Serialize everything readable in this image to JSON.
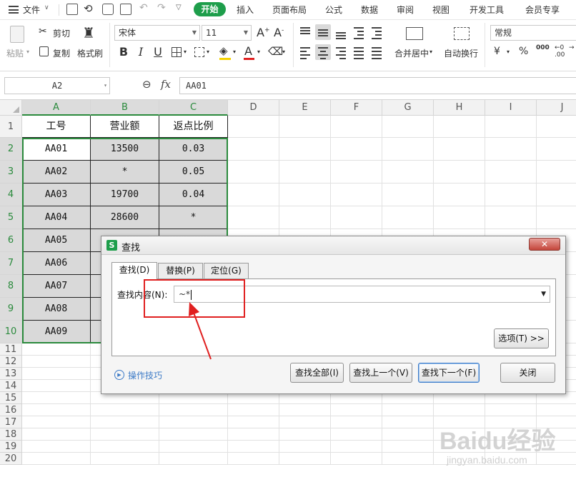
{
  "menu": {
    "file_label": "文件",
    "tabs": [
      {
        "label": "开始",
        "active": true
      },
      {
        "label": "插入"
      },
      {
        "label": "页面布局"
      },
      {
        "label": "公式"
      },
      {
        "label": "数据"
      },
      {
        "label": "审阅"
      },
      {
        "label": "视图"
      },
      {
        "label": "开发工具"
      },
      {
        "label": "会员专享"
      }
    ],
    "accent_color": "#1e9e4b"
  },
  "ribbon": {
    "paste_label": "粘贴",
    "cut_label": "剪切",
    "copy_label": "复制",
    "format_painter_label": "格式刷",
    "font_name": "宋体",
    "font_size": "11",
    "bold": "B",
    "italic": "I",
    "underline": "U",
    "merge_label": "合并居中",
    "wrap_label": "自动换行",
    "number_format": "常规",
    "currency_symbol": "¥",
    "percent_symbol": "%",
    "thousands_symbol": "000"
  },
  "formula_bar": {
    "name_box": "A2",
    "fx": "fx",
    "content": "AA01"
  },
  "grid": {
    "columns": [
      "A",
      "B",
      "C",
      "D",
      "E",
      "F",
      "G",
      "H",
      "I",
      "J"
    ],
    "rows": [
      "1",
      "2",
      "3",
      "4",
      "5",
      "6",
      "7",
      "8",
      "9",
      "10",
      "11",
      "12",
      "13",
      "14",
      "15",
      "16",
      "17",
      "18",
      "19",
      "20"
    ],
    "headers": [
      "工号",
      "营业额",
      "返点比例"
    ],
    "data": [
      [
        "AA01",
        "13500",
        "0.03"
      ],
      [
        "AA02",
        "*",
        "0.05"
      ],
      [
        "AA03",
        "19700",
        "0.04"
      ],
      [
        "AA04",
        "28600",
        "*"
      ],
      [
        "AA05",
        "",
        ""
      ],
      [
        "AA06",
        "",
        ""
      ],
      [
        "AA07",
        "",
        ""
      ],
      [
        "AA08",
        "",
        ""
      ],
      [
        "AA09",
        "",
        ""
      ]
    ],
    "selection_color": "#2a8a3c"
  },
  "dialog": {
    "title": "查找",
    "tabs": [
      "查找(D)",
      "替换(P)",
      "定位(G)"
    ],
    "find_label": "查找内容(N):",
    "find_value": "~*",
    "options_button": "选项(T) >>",
    "tips_link": "操作技巧",
    "buttons": {
      "find_all": "查找全部(I)",
      "find_prev": "查找上一个(V)",
      "find_next": "查找下一个(F)",
      "close": "关闭"
    }
  },
  "annotation_color": "#e02020",
  "watermark": {
    "brand": "Baidu经验",
    "url": "jingyan.baidu.com"
  }
}
